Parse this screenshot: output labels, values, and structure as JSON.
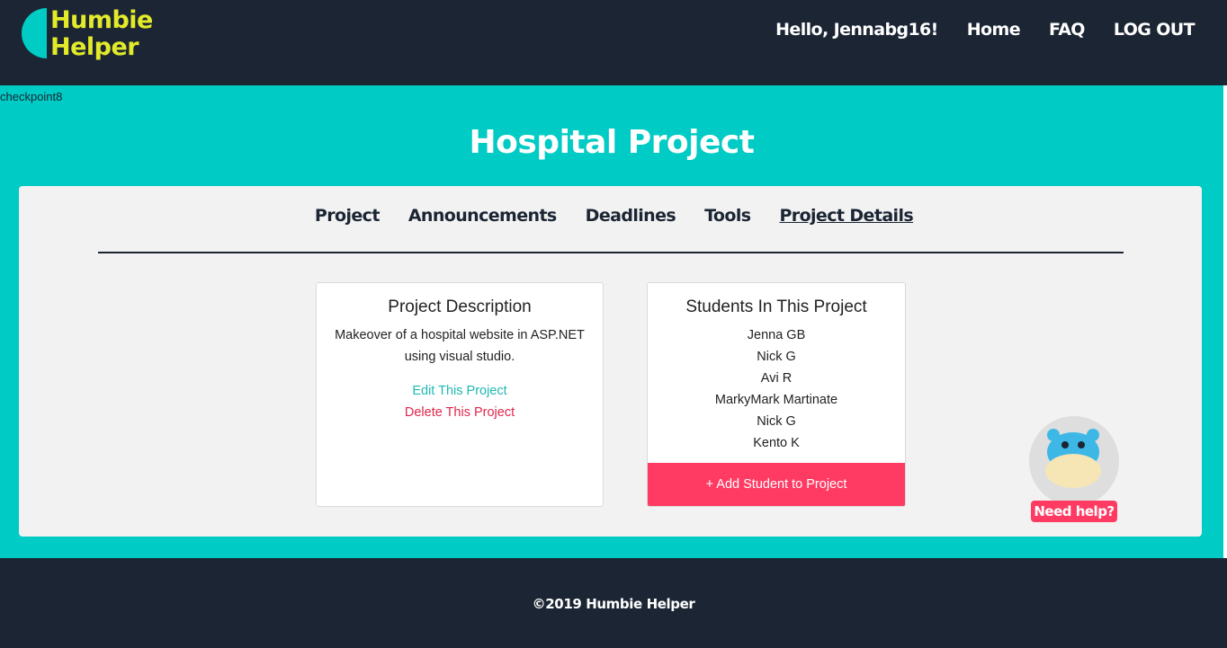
{
  "header": {
    "logo_line1": "Humbie",
    "logo_line2": "Helper",
    "greeting": "Hello, Jennabg16!",
    "nav_home": "Home",
    "nav_faq": "FAQ",
    "nav_logout": "LOG OUT"
  },
  "debug_text": "checkpoint8",
  "page_title": "Hospital Project",
  "tabs": [
    {
      "label": "Project"
    },
    {
      "label": "Announcements"
    },
    {
      "label": "Deadlines"
    },
    {
      "label": "Tools"
    },
    {
      "label": "Project Details",
      "active": true
    }
  ],
  "description_card": {
    "title": "Project Description",
    "text": "Makeover of a hospital website in ASP.NET using visual studio.",
    "edit_label": "Edit This Project",
    "delete_label": "Delete This Project"
  },
  "students_card": {
    "title": "Students In This Project",
    "students": [
      "Jenna GB",
      "Nick G",
      "Avi R",
      "MarkyMark Martinate",
      "Nick G",
      "Kento K"
    ],
    "add_label": "+ Add Student to Project"
  },
  "help": {
    "label": "Need help?",
    "icon": "hippo-icon"
  },
  "footer": {
    "text": "©2019 Humbie Helper"
  },
  "colors": {
    "navy": "#1b2533",
    "teal": "#00cbc4",
    "logo_yellow": "#e2ea2a",
    "pink": "#ff3b63",
    "edit_teal": "#1fb9b2",
    "delete_red": "#e0264a"
  }
}
